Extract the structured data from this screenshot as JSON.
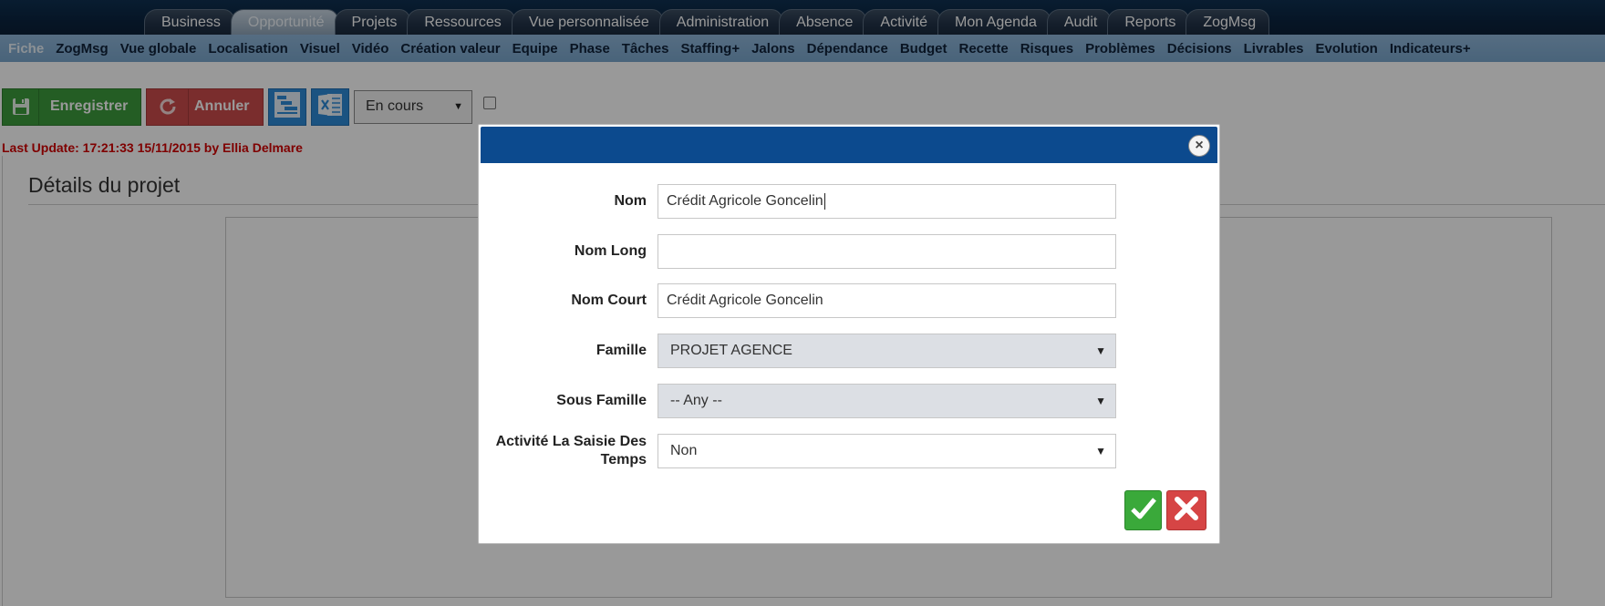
{
  "top_tabs": [
    {
      "label": "Business"
    },
    {
      "label": "Opportunité",
      "active": true
    },
    {
      "label": "Projets"
    },
    {
      "label": "Ressources"
    },
    {
      "label": "Vue personnalisée"
    },
    {
      "label": "Administration"
    },
    {
      "label": "Absence"
    },
    {
      "label": "Activité"
    },
    {
      "label": "Mon Agenda"
    },
    {
      "label": "Audit"
    },
    {
      "label": "Reports"
    },
    {
      "label": "ZogMsg"
    }
  ],
  "sub_nav": [
    {
      "label": "Fiche",
      "active": true
    },
    {
      "label": "ZogMsg"
    },
    {
      "label": "Vue globale"
    },
    {
      "label": "Localisation"
    },
    {
      "label": "Visuel"
    },
    {
      "label": "Vidéo"
    },
    {
      "label": "Création valeur"
    },
    {
      "label": "Equipe"
    },
    {
      "label": "Phase"
    },
    {
      "label": "Tâches"
    },
    {
      "label": "Staffing+"
    },
    {
      "label": "Jalons"
    },
    {
      "label": "Dépendance"
    },
    {
      "label": "Budget"
    },
    {
      "label": "Recette"
    },
    {
      "label": "Risques"
    },
    {
      "label": "Problèmes"
    },
    {
      "label": "Décisions"
    },
    {
      "label": "Livrables"
    },
    {
      "label": "Evolution"
    },
    {
      "label": "Indicateurs+"
    }
  ],
  "toolbar": {
    "save_label": "Enregistrer",
    "cancel_label": "Annuler",
    "status_value": "En cours"
  },
  "last_update": "Last Update: 17:21:33 15/11/2015 by Ellia Delmare",
  "section_title": "Détails du projet",
  "modal": {
    "close_glyph": "×",
    "fields": {
      "nom": {
        "label": "Nom",
        "value": "Crédit Agricole Goncelin"
      },
      "nom_long": {
        "label": "Nom Long",
        "value": ""
      },
      "nom_court": {
        "label": "Nom Court",
        "value": "Crédit Agricole Goncelin"
      },
      "famille": {
        "label": "Famille",
        "value": "PROJET AGENCE"
      },
      "sous_famille": {
        "label": "Sous Famille",
        "value": "-- Any --"
      },
      "activite": {
        "label": "Activité La Saisie Des Temps",
        "value": "Non"
      }
    }
  },
  "colors": {
    "save_green": "#3c9b3c",
    "cancel_red": "#cc4c4c",
    "modal_header": "#0c4a8e",
    "update_red": "#d40000"
  },
  "icons": {
    "save": "floppy-disk-icon",
    "cancel": "refresh-icon",
    "gantt": "gantt-chart-icon",
    "excel": "excel-icon",
    "close": "close-circle-icon",
    "ok": "checkmark-icon",
    "cancel_modal": "x-mark-icon"
  }
}
